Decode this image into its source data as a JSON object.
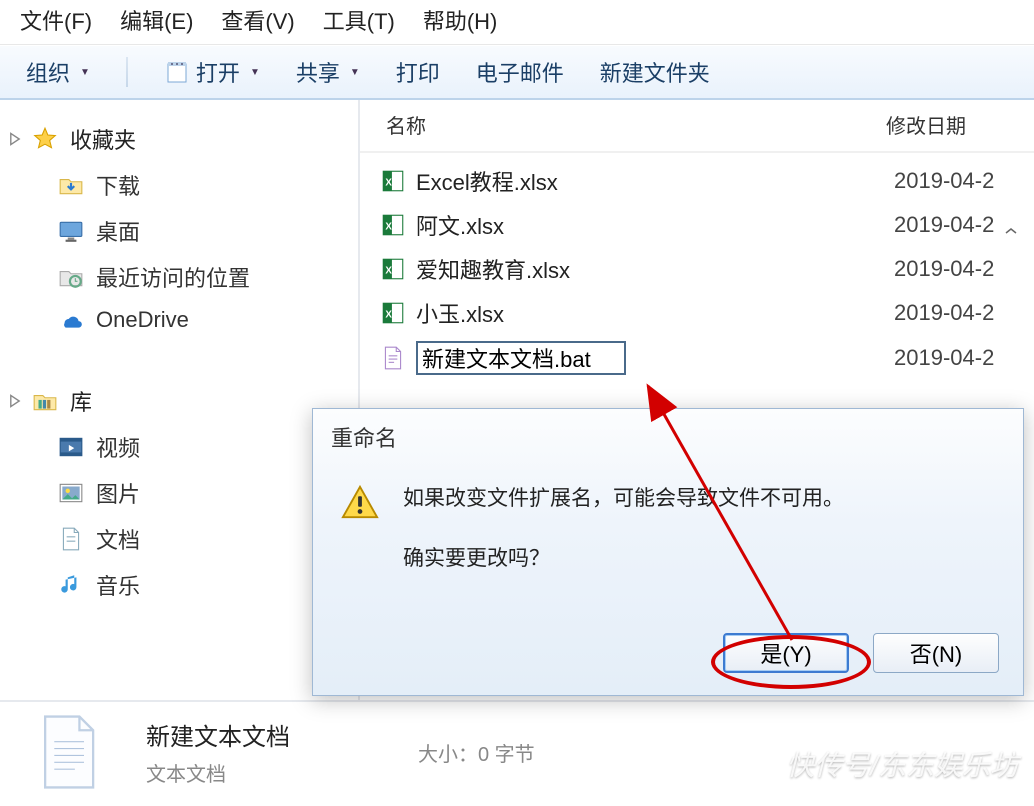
{
  "menubar": {
    "file": "文件(F)",
    "edit": "编辑(E)",
    "view": "查看(V)",
    "tools": "工具(T)",
    "help": "帮助(H)"
  },
  "toolbar": {
    "organize": "组织",
    "open": "打开",
    "share": "共享",
    "print": "打印",
    "email": "电子邮件",
    "newfolder": "新建文件夹"
  },
  "sidebar": {
    "favorites": "收藏夹",
    "downloads": "下载",
    "desktop": "桌面",
    "recent": "最近访问的位置",
    "onedrive": "OneDrive",
    "libraries": "库",
    "videos": "视频",
    "pictures": "图片",
    "documents": "文档",
    "music": "音乐"
  },
  "columns": {
    "name": "名称",
    "date": "修改日期"
  },
  "files": [
    {
      "name": "Excel教程.xlsx",
      "date": "2019-04-2",
      "type": "xlsx"
    },
    {
      "name": "阿文.xlsx",
      "date": "2019-04-2",
      "type": "xlsx"
    },
    {
      "name": "爱知趣教育.xlsx",
      "date": "2019-04-2",
      "type": "xlsx"
    },
    {
      "name": "小玉.xlsx",
      "date": "2019-04-2",
      "type": "xlsx"
    }
  ],
  "rename": {
    "value": "新建文本文档.bat",
    "date": "2019-04-2"
  },
  "details": {
    "title": "新建文本文档",
    "type": "文本文档",
    "size_label": "大小：0 字节"
  },
  "dialog": {
    "title": "重命名",
    "line1": "如果改变文件扩展名，可能会导致文件不可用。",
    "line2": "确实要更改吗？",
    "yes": "是(Y)",
    "no": "否(N)"
  },
  "watermark": "快传号/东东娱乐坊"
}
